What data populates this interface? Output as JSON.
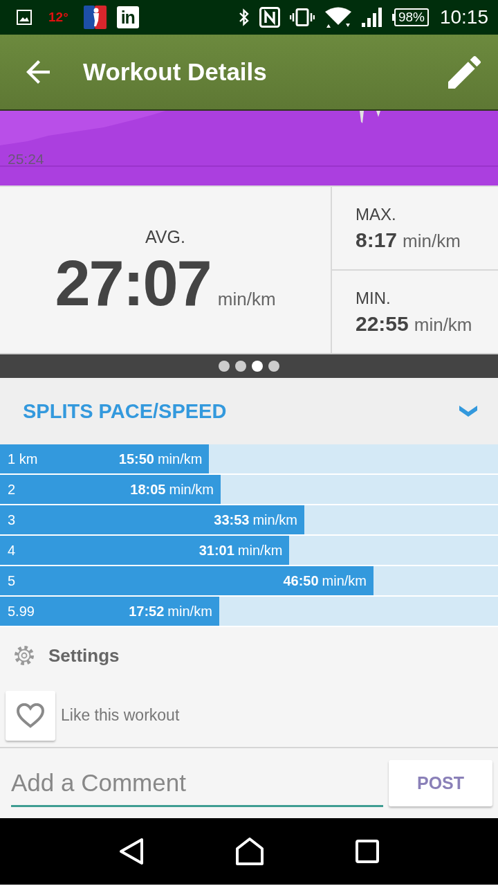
{
  "status_bar": {
    "temperature": "12°",
    "logo_badge": "in",
    "battery": "98%",
    "time": "10:15"
  },
  "app_bar": {
    "title": "Workout Details"
  },
  "pace_chart": {
    "label": "25:24"
  },
  "stats": {
    "average": {
      "label": "AVG.",
      "value": "27:07",
      "unit": "min/km"
    },
    "others": [
      {
        "label": "MAX.",
        "value": "8:17",
        "unit": "min/km"
      },
      {
        "label": "MIN.",
        "value": "22:55",
        "unit": "min/km"
      }
    ]
  },
  "pager": {
    "dots": [
      {
        "selected": false
      },
      {
        "selected": false
      },
      {
        "selected": true
      },
      {
        "selected": false
      }
    ]
  },
  "splits": {
    "title": "SPLITS PACE/SPEED",
    "rows": [
      {
        "label": "1 km",
        "pace": "15:50",
        "unit": "min/km",
        "level": 0.42
      },
      {
        "label": "2",
        "pace": "18:05",
        "unit": "min/km",
        "level": 0.443
      },
      {
        "label": "3",
        "pace": "33:53",
        "unit": "min/km",
        "level": 0.611
      },
      {
        "label": "4",
        "pace": "31:01",
        "unit": "min/km",
        "level": 0.581
      },
      {
        "label": "5",
        "pace": "46:50",
        "unit": "min/km",
        "level": 0.75
      },
      {
        "label": "5.99",
        "pace": "17:52",
        "unit": "min/km",
        "level": 0.44
      }
    ]
  },
  "settings": {
    "label": "Settings"
  },
  "like": {
    "label": "Like this workout"
  },
  "comment": {
    "placeholder": "Add a Comment",
    "button": "POST"
  }
}
